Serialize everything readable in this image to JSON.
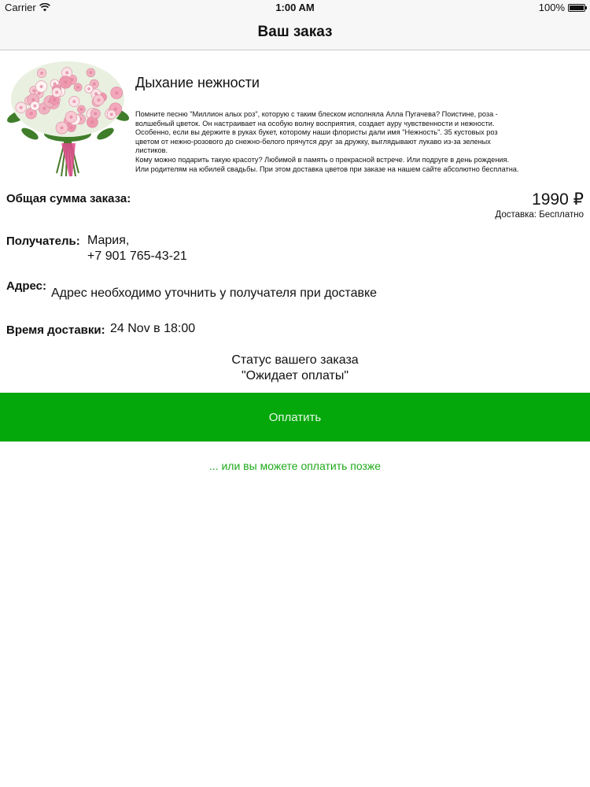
{
  "statusbar": {
    "carrier": "Carrier",
    "wifi_icon": "wifi-icon",
    "time": "1:00 AM",
    "battery_percent": "100%",
    "battery_level": 1.0
  },
  "navbar": {
    "title": "Ваш заказ"
  },
  "product": {
    "image_icon": "flower-bouquet-image",
    "title": "Дыхание нежности",
    "description": "Помните песню \"Миллион алых роз\", которую с таким блеском исполняла Алла Пугачева? Поистине, роза -\nволшебный цветок. Он настраивает на особую волну восприятия, создает ауру чувственности и нежности.\nОсобенно, если вы держите в руках букет, которому наши флористы дали имя \"Нежность\". 35 кустовых роз\nцветом от нежно-розового до снежно-белого прячутся друг за дружку, выглядывают лукаво из-за зеленых\nлистиков.\nКому можно подарить такую красоту? Любимой в память о прекрасной встрече. Или подруге в день рождения.\nИли родителям на юбилей свадьбы. При этом доставка цветов при заказе на нашем сайте абсолютно бесплатна."
  },
  "order": {
    "total_label": "Общая сумма заказа:",
    "total_price": "1990 ₽",
    "delivery_note": "Доставка: Бесплатно",
    "recipient_label": "Получатель:",
    "recipient_name": "Мария,",
    "recipient_phone": "+7 901 765-43-21",
    "address_label": "Адрес:",
    "address_value": "Адрес необходимо уточнить у получателя при доставке",
    "time_label": "Время доставки:",
    "time_value": "24 Nov в 18:00",
    "status_title": "Статус вашего заказа",
    "status_value": "\"Ожидает оплаты\""
  },
  "actions": {
    "pay_label": "Оплатить",
    "pay_later_label": "... или вы можете оплатить позже"
  },
  "colors": {
    "accent_green": "#04a80b",
    "link_green": "#1faa1a",
    "navbar_bg": "#f7f7f8"
  }
}
